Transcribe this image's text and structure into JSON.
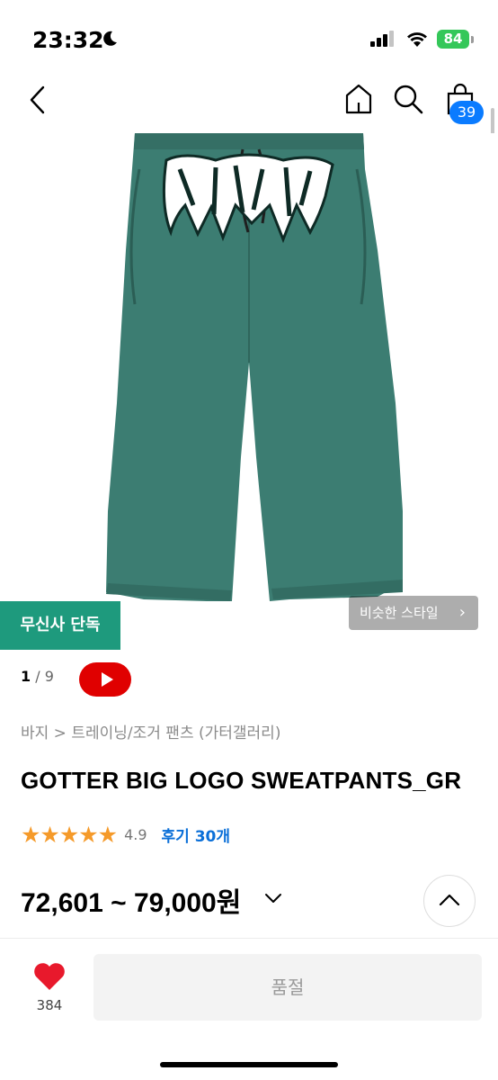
{
  "status_bar": {
    "time": "23:32",
    "battery": "84"
  },
  "nav": {
    "cart_count": "39"
  },
  "image": {
    "exclusive_badge": "무신사 단독",
    "similar_style_label": "비슷한 스타일",
    "pager_current": "1",
    "pager_total": " / 9"
  },
  "product": {
    "breadcrumb": "바지 > 트레이닝/조거 팬츠 (가터갤러리)",
    "title": "GOTTER BIG LOGO SWEATPANTS_GR",
    "rating": "4.9",
    "reviews_label": "후기 30개",
    "price": "72,601 ~ 79,000원"
  },
  "bottom_bar": {
    "like_count": "384",
    "soldout_label": "품절"
  },
  "colors": {
    "accent_blue": "#0a7bff",
    "exclusive_green": "#1e9a7d",
    "star": "#f59a2a",
    "heart": "#e8192c",
    "pants": "#3c7d72"
  }
}
